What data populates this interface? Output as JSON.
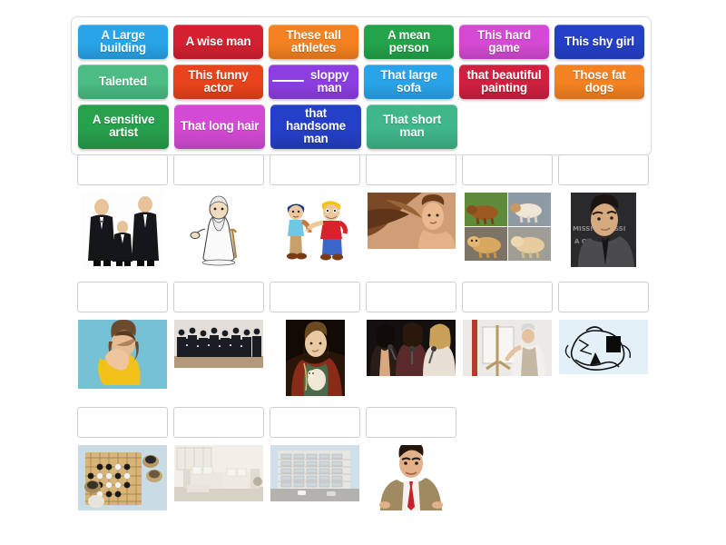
{
  "wordbank": {
    "rows": [
      [
        {
          "label": "A Large building",
          "color": "#29a4e8",
          "blank": false
        },
        {
          "label": "A wise man",
          "color": "#d42030",
          "blank": false
        },
        {
          "label": "These tall athletes",
          "color": "#f58220",
          "blank": false
        },
        {
          "label": "A mean person",
          "color": "#23a34a",
          "blank": false
        },
        {
          "label": "This hard game",
          "color": "#d44ad4",
          "blank": false
        },
        {
          "label": "This shy girl",
          "color": "#2540c8",
          "blank": false
        }
      ],
      [
        {
          "label": "Talented",
          "color": "#4cbb84",
          "blank": false
        },
        {
          "label": "This funny actor",
          "color": "#e8431a",
          "blank": false
        },
        {
          "label": "sloppy man",
          "color": "#8c3ee0",
          "blank": true
        },
        {
          "label": "That large sofa",
          "color": "#29a4e8",
          "blank": false
        },
        {
          "label": "that beautiful painting",
          "color": "#cf2040",
          "blank": false
        },
        {
          "label": "Those fat dogs",
          "color": "#f58220",
          "blank": false
        }
      ],
      [
        {
          "label": "A sensitive artist",
          "color": "#27a04c",
          "blank": false
        },
        {
          "label": "That long hair",
          "color": "#d44ad4",
          "blank": false
        },
        {
          "label": "that handsome man",
          "color": "#2540c8",
          "blank": false
        },
        {
          "label": "That short man",
          "color": "#3fb789",
          "blank": false
        }
      ]
    ]
  },
  "answer_rows": [
    {
      "dropzones": [
        "",
        "",
        "",
        "",
        "",
        ""
      ],
      "images": [
        {
          "name": "three-men-in-tuxedos-different-heights",
          "kind": "photo"
        },
        {
          "name": "old-wise-man-with-cane-cartoon",
          "kind": "cartoon"
        },
        {
          "name": "two-cartoon-boys-one-pointing",
          "kind": "cartoon"
        },
        {
          "name": "woman-with-long-flowing-brown-hair",
          "kind": "photo"
        },
        {
          "name": "collage-of-four-fat-dogs",
          "kind": "photo"
        },
        {
          "name": "handsome-man-on-red-carpet",
          "kind": "photo"
        }
      ]
    },
    {
      "dropzones": [
        "",
        "",
        "",
        "",
        "",
        ""
      ],
      "images": [
        {
          "name": "shy-girl-in-yellow-sweater-covering-face",
          "kind": "photo"
        },
        {
          "name": "group-of-people-in-black-posing",
          "kind": "photo"
        },
        {
          "name": "renaissance-painting-lady-with-ermine",
          "kind": "photo"
        },
        {
          "name": "three-women-singing-into-microphones",
          "kind": "photo"
        },
        {
          "name": "artist-painting-at-easel",
          "kind": "photo"
        },
        {
          "name": "abstract-black-and-white-sketch",
          "kind": "photo"
        }
      ]
    },
    {
      "dropzones": [
        "",
        "",
        "",
        ""
      ],
      "images": [
        {
          "name": "go-board-game-with-stones",
          "kind": "photo"
        },
        {
          "name": "large-white-sectional-sofa-in-living-room",
          "kind": "photo"
        },
        {
          "name": "large-apartment-building-exterior",
          "kind": "photo"
        },
        {
          "name": "mr-bean-in-brown-suit-and-red-tie",
          "kind": "photo"
        }
      ]
    }
  ]
}
